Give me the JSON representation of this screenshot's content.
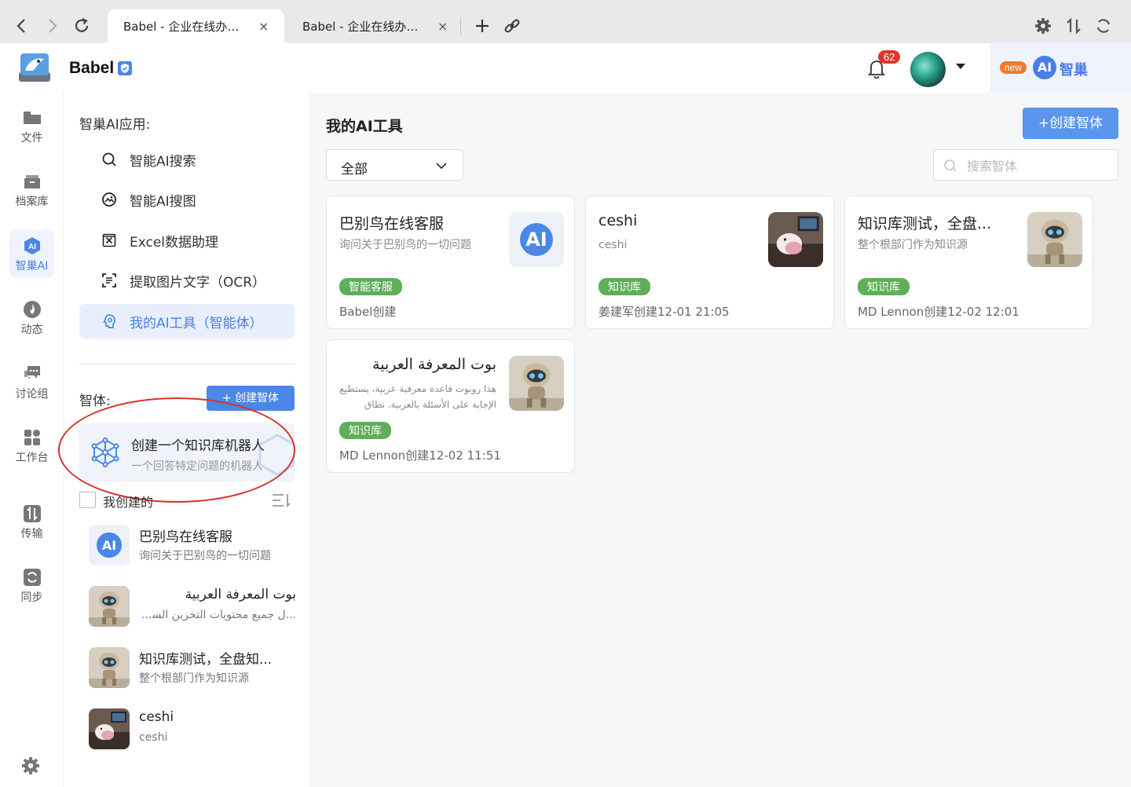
{
  "browser": {
    "tabs": [
      {
        "title": "Babel - 企业在线办公...",
        "active": true
      },
      {
        "title": "Babel - 企业在线办公...",
        "active": false
      }
    ],
    "close_glyph": "×"
  },
  "header": {
    "brand": "Babel",
    "notification_count": "62",
    "new_label": "new",
    "ai_logo_text": "AI",
    "ai_name": "智巢"
  },
  "rail": {
    "items": [
      {
        "label": "文件",
        "icon": "folder-icon"
      },
      {
        "label": "档案库",
        "icon": "archive-icon"
      },
      {
        "label": "智巢AI",
        "icon": "ai-icon",
        "active": true
      },
      {
        "label": "动态",
        "icon": "flame-icon"
      },
      {
        "label": "讨论组",
        "icon": "chat-icon"
      },
      {
        "label": "工作台",
        "icon": "grid-icon"
      },
      {
        "label": "传输",
        "icon": "transfer-icon"
      },
      {
        "label": "同步",
        "icon": "sync-icon"
      }
    ]
  },
  "apps": {
    "title": "智巢AI应用:",
    "items": [
      {
        "label": "智能AI搜索",
        "icon": "search-icon"
      },
      {
        "label": "智能AI搜图",
        "icon": "image-search-icon"
      },
      {
        "label": "Excel数据助理",
        "icon": "excel-icon"
      },
      {
        "label": "提取图片文字（OCR）",
        "icon": "ocr-icon"
      },
      {
        "label": "我的AI工具（智能体）",
        "icon": "agent-icon",
        "active": true
      }
    ]
  },
  "agents": {
    "title": "智体:",
    "create_label": "+ 创建智体",
    "kb_title": "创建一个知识库机器人",
    "kb_subtitle": "一个回答特定问题的机器人",
    "mine_label": "我创建的",
    "list": [
      {
        "name": "巴别鸟在线客服",
        "desc": "询问关于巴别鸟的一切问题",
        "thumb": "ai"
      },
      {
        "name": "بوت المعرفة العربية",
        "desc": "...ل جميع محتويات التخزين السحابي",
        "thumb": "robot",
        "rtl": true
      },
      {
        "name": "知识库测试，全盘知...",
        "desc": "整个根部门作为知识源",
        "thumb": "robot"
      },
      {
        "name": "ceshi",
        "desc": "ceshi",
        "thumb": "photo"
      }
    ]
  },
  "main": {
    "title": "我的AI工具",
    "create_label": "+创建智体",
    "filter_value": "全部",
    "search_placeholder": "搜索智体",
    "cards": [
      {
        "title": "巴别鸟在线客服",
        "desc": "询问关于巴别鸟的一切问题",
        "tag": "智能客服",
        "meta": "Babel创建",
        "thumb": "ai"
      },
      {
        "title": "ceshi",
        "desc": "ceshi",
        "tag": "知识库",
        "meta": "姜建军创建12-01 21:05",
        "thumb": "photo"
      },
      {
        "title": "知识库测试，全盘...",
        "desc": "整个根部门作为知识源",
        "tag": "知识库",
        "meta": "MD Lennon创建12-02 12:01",
        "thumb": "robot"
      },
      {
        "title": "بوت المعرفة العربية",
        "desc": "هذا روبوت قاعدة معرفية عربية، يستطيع الإجابة على الأسئلة بالعربية. نطاق قاعدة",
        "tag": "知识库",
        "meta": "MD Lennon创建12-02 11:51",
        "thumb": "robot",
        "rtl": true
      }
    ]
  },
  "colors": {
    "accent": "#4a87e8",
    "tag_green": "#5fae5a",
    "badge_red": "#e0352b",
    "annotation_red": "#d9312a"
  }
}
